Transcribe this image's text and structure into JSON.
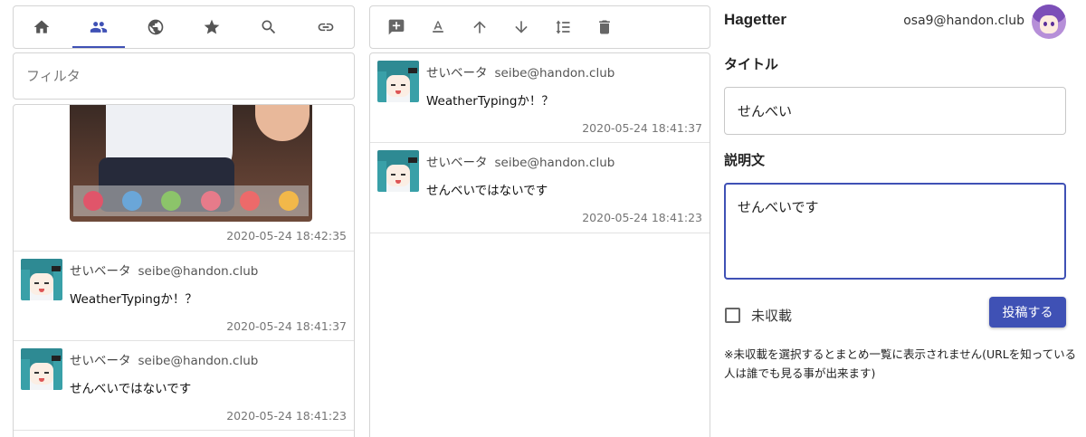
{
  "left_toolbar": {
    "tabs": [
      {
        "icon": "home-icon"
      },
      {
        "icon": "people-icon",
        "active": true
      },
      {
        "icon": "globe-icon"
      },
      {
        "icon": "star-icon"
      },
      {
        "icon": "search-icon"
      },
      {
        "icon": "link-icon"
      }
    ]
  },
  "filter": {
    "placeholder": "フィルタ",
    "value": ""
  },
  "left_feed": {
    "image_post": {
      "time": "2020-05-24 18:42:35"
    },
    "posts": [
      {
        "name": "せいベータ",
        "acct": "seibe@handon.club",
        "text": "WeatherTypingか！？",
        "time": "2020-05-24 18:41:37"
      },
      {
        "name": "せいベータ",
        "acct": "seibe@handon.club",
        "text": "せんべいではないです",
        "time": "2020-05-24 18:41:23"
      }
    ]
  },
  "mid_toolbar": {
    "tools": [
      "add-comment-icon",
      "text-format-icon",
      "arrow-up-icon",
      "arrow-down-icon",
      "sort-icon",
      "trash-icon"
    ]
  },
  "mid_feed": {
    "posts": [
      {
        "name": "せいベータ",
        "acct": "seibe@handon.club",
        "text": "WeatherTypingか！？",
        "time": "2020-05-24 18:41:37"
      },
      {
        "name": "せいベータ",
        "acct": "seibe@handon.club",
        "text": "せんべいではないです",
        "time": "2020-05-24 18:41:23"
      }
    ]
  },
  "header": {
    "app_title": "Hagetter",
    "user": "osa9@handon.club"
  },
  "form": {
    "title_label": "タイトル",
    "title_value": "せんべい",
    "desc_label": "説明文",
    "desc_value": "せんべいです",
    "unlisted_label": "未収載",
    "unlisted_checked": false,
    "submit_label": "投稿する",
    "note": "※未収載を選択するとまとめ一覧に表示されません(URLを知っている人は誰でも見る事が出来ます)"
  },
  "colors": {
    "accent": "#3f51b5",
    "border": "#d4d4d4",
    "muted_text": "#757575"
  }
}
